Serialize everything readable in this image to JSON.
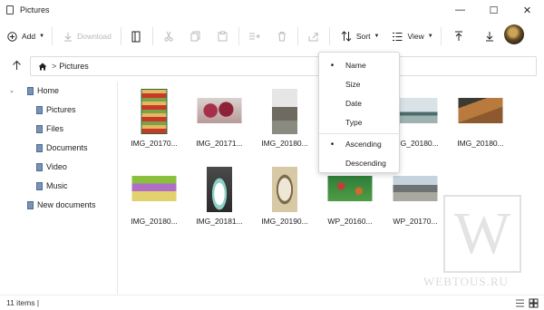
{
  "window": {
    "title": "Pictures",
    "buttons": {
      "minimize": "—",
      "maximize": "☐",
      "close": "✕"
    }
  },
  "toolbar": {
    "add_label": "Add",
    "download_label": "Download",
    "sort_label": "Sort",
    "view_label": "View"
  },
  "address": {
    "crumb": "Pictures",
    "separator": ">"
  },
  "sidebar": {
    "root": "Home",
    "children": [
      "Pictures",
      "Files",
      "Documents",
      "Video",
      "Music"
    ],
    "other": "New documents"
  },
  "files": [
    {
      "name": "IMG_20170...",
      "icon": "photo-market"
    },
    {
      "name": "IMG_20171...",
      "icon": "photo-flowers"
    },
    {
      "name": "IMG_20180...",
      "icon": "photo-tree"
    },
    {
      "name": "",
      "icon": "photo-hidden"
    },
    {
      "name": "IMG_20180...",
      "icon": "photo-office"
    },
    {
      "name": "IMG_20180...",
      "icon": "photo-bread"
    },
    {
      "name": "IMG_20180...",
      "icon": "photo-toys"
    },
    {
      "name": "IMG_20181...",
      "icon": "photo-unicorn"
    },
    {
      "name": "IMG_20190...",
      "icon": "photo-painting"
    },
    {
      "name": "WP_20160...",
      "icon": "photo-garden"
    },
    {
      "name": "WP_20170...",
      "icon": "photo-street"
    }
  ],
  "sort_menu": {
    "fields": [
      "Name",
      "Size",
      "Date",
      "Type"
    ],
    "selected_field": "Name",
    "orders": [
      "Ascending",
      "Descending"
    ],
    "selected_order": "Ascending"
  },
  "status": {
    "count": "11 items |"
  },
  "watermark": {
    "letter": "W",
    "text": "WEBTOUS.RU"
  },
  "colors": {
    "accent": "#4d6b91",
    "menu_border": "#d6d6d6"
  }
}
